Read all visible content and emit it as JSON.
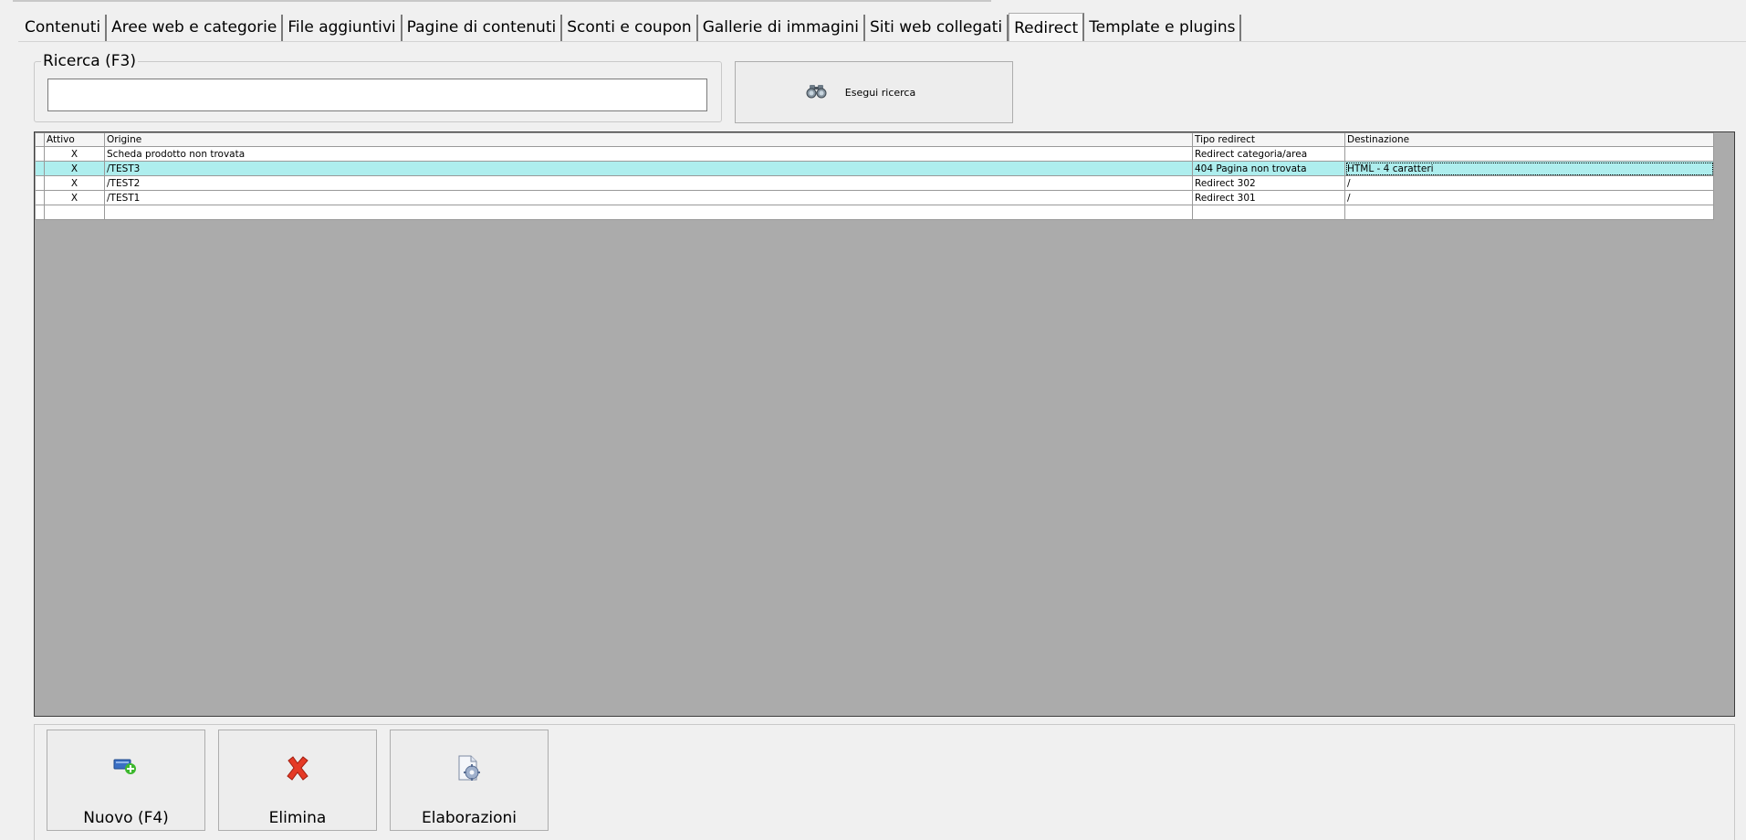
{
  "tabs": [
    {
      "label": "Contenuti"
    },
    {
      "label": "Aree web e categorie"
    },
    {
      "label": "File aggiuntivi"
    },
    {
      "label": "Pagine di contenuti"
    },
    {
      "label": "Sconti e coupon"
    },
    {
      "label": "Gallerie di immagini"
    },
    {
      "label": "Siti web collegati"
    },
    {
      "label": "Redirect"
    },
    {
      "label": "Template e plugins"
    }
  ],
  "active_tab": "Redirect",
  "search": {
    "legend": "Ricerca (F3)",
    "value": "",
    "button_label": "Esegui ricerca",
    "button_icon": "binoculars-icon"
  },
  "grid": {
    "columns": [
      "Attivo",
      "Origine",
      "Tipo redirect",
      "Destinazione"
    ],
    "rows": [
      {
        "attivo": "X",
        "origine": "Scheda prodotto non trovata",
        "tipo": "Redirect categoria/area",
        "destinazione": ""
      },
      {
        "attivo": "X",
        "origine": "/TEST3",
        "tipo": "404 Pagina non trovata",
        "destinazione": "HTML - 4 caratteri"
      },
      {
        "attivo": "X",
        "origine": "/TEST2",
        "tipo": "Redirect 302",
        "destinazione": "/"
      },
      {
        "attivo": "X",
        "origine": "/TEST1",
        "tipo": "Redirect 301",
        "destinazione": "/"
      },
      {
        "attivo": "",
        "origine": "",
        "tipo": "",
        "destinazione": ""
      }
    ],
    "highlight_color": "#aeeeee",
    "empty_area_color": "#ababab"
  },
  "actions": {
    "new_label": "Nuovo (F4)",
    "new_icon": "add-record-icon",
    "delete_label": "Elimina",
    "delete_icon": "delete-x-icon",
    "process_label": "Elaborazioni",
    "process_icon": "document-gear-icon"
  }
}
